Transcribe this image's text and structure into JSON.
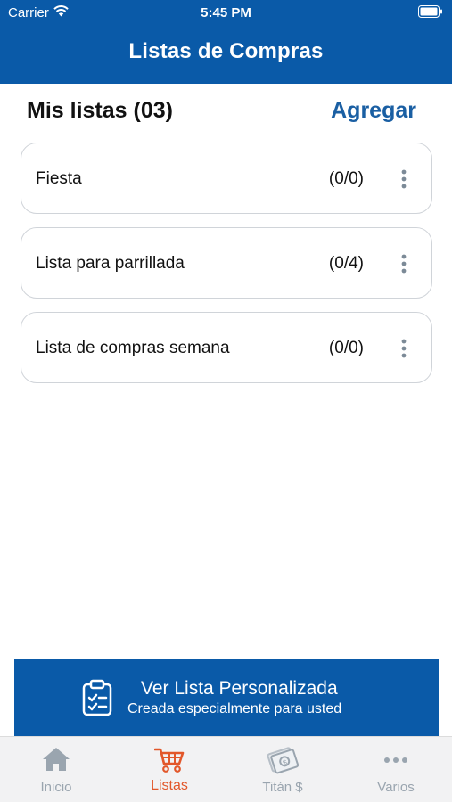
{
  "status_bar": {
    "carrier": "Carrier",
    "time": "5:45 PM"
  },
  "nav": {
    "title": "Listas de Compras"
  },
  "header": {
    "title": "Mis listas (03)",
    "add_label": "Agregar"
  },
  "lists": [
    {
      "name": "Fiesta",
      "count": "(0/0)"
    },
    {
      "name": "Lista para parrillada",
      "count": "(0/4)"
    },
    {
      "name": "Lista de compras semana",
      "count": "(0/0)"
    }
  ],
  "promo": {
    "title": "Ver Lista Personalizada",
    "subtitle": "Creada especialmente para usted",
    "icon": "clipboard-check-icon"
  },
  "tabs": [
    {
      "label": "Inicio",
      "icon": "home-icon",
      "active": false
    },
    {
      "label": "Listas",
      "icon": "cart-icon",
      "active": true
    },
    {
      "label": "Titán $",
      "icon": "money-icon",
      "active": false
    },
    {
      "label": "Varios",
      "icon": "more-icon",
      "active": false
    }
  ],
  "colors": {
    "primary": "#0a5aa8",
    "accent": "#e2572a",
    "link": "#1a5fa3",
    "inactive_tab": "#9aa5af"
  }
}
